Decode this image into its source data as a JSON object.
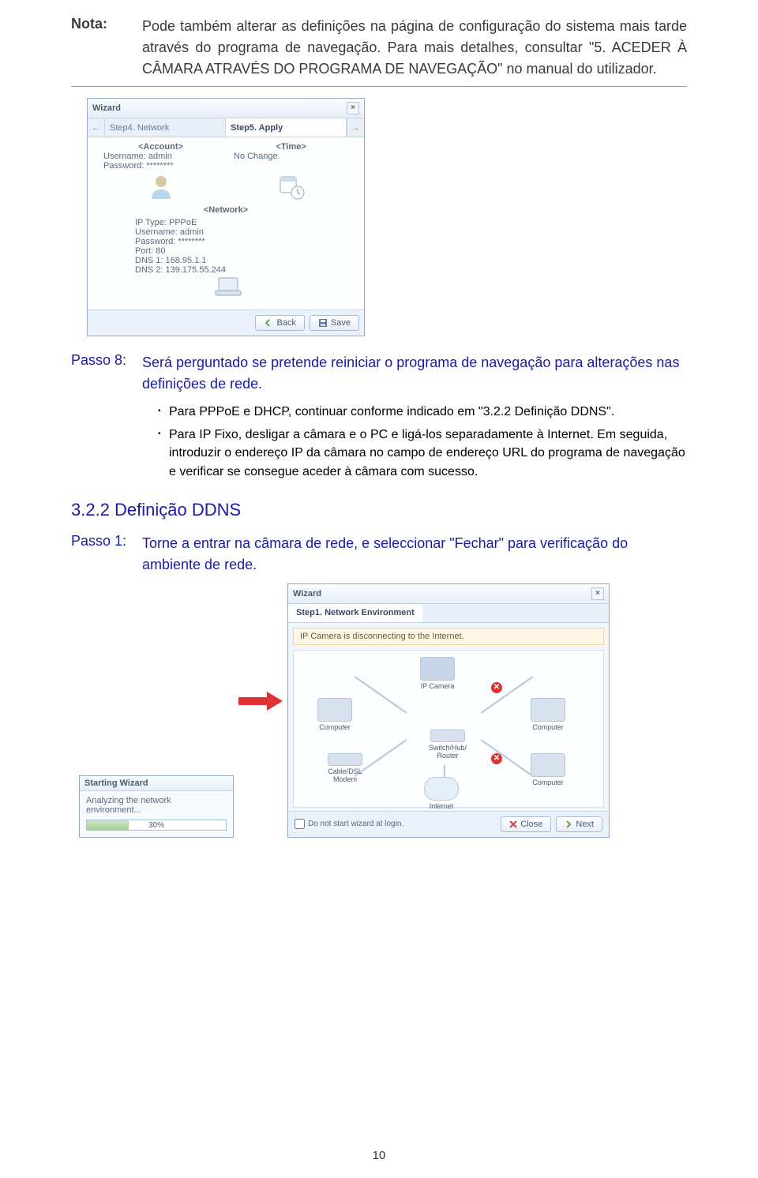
{
  "note": {
    "label": "Nota:",
    "text": "Pode também alterar as definições na página de configuração do sistema mais tarde através do programa de navegação. Para mais detalhes, consultar \"5. ACEDER À CÂMARA ATRAVÉS DO PROGRAMA DE NAVEGAÇÃO\" no manual do utilizador."
  },
  "wizard1": {
    "title": "Wizard",
    "prev_arrow": "←",
    "next_arrow": "→",
    "step_prev": "Step4. Network",
    "step_active": "Step5. Apply",
    "account": {
      "heading": "<Account>",
      "username": "Username: admin",
      "password": "Password: ********"
    },
    "time": {
      "heading": "<Time>",
      "value": "No Change."
    },
    "network": {
      "heading": "<Network>",
      "ip_type": "IP Type: PPPoE",
      "username": "Username: admin",
      "password": "Password: ********",
      "port": "Port: 80",
      "dns1": "DNS 1: 168.95.1.1",
      "dns2": "DNS 2: 139.175.55.244"
    },
    "btn_back": "Back",
    "btn_save": "Save"
  },
  "passo8": {
    "label": "Passo 8:",
    "text": "Será perguntado se pretende reiniciar o programa de navegação para alterações nas definições de rede.",
    "bullet1": "Para PPPoE e DHCP, continuar conforme indicado em \"3.2.2 Definição DDNS\".",
    "bullet2": "Para IP Fixo, desligar a câmara e o PC e ligá-los separadamente à Internet. Em seguida, introduzir o endereço IP da câmara no campo de endereço URL do programa de navegação e verificar se consegue aceder à câmara com sucesso."
  },
  "section322": "3.2.2 Definição DDNS",
  "passo1": {
    "label": "Passo 1:",
    "text": "Torne a entrar na câmara de rede, e seleccionar \"Fechar\" para verificação do ambiente de rede."
  },
  "starting": {
    "title": "Starting Wizard",
    "msg": "Analyzing the network environment...",
    "pct": "30%"
  },
  "wizard2": {
    "title": "Wizard",
    "step": "Step1. Network Environment",
    "banner": "IP Camera is disconnecting to the Internet.",
    "labels": {
      "ipcam": "IP Camera",
      "comp": "Computer",
      "modem": "Cable/DSL Modem",
      "switch": "Switch/Hub/ Router",
      "internet": "Internet"
    },
    "chk": "Do not start wizard at login.",
    "btn_close": "Close",
    "btn_next": "Next"
  },
  "pagenum": "10"
}
